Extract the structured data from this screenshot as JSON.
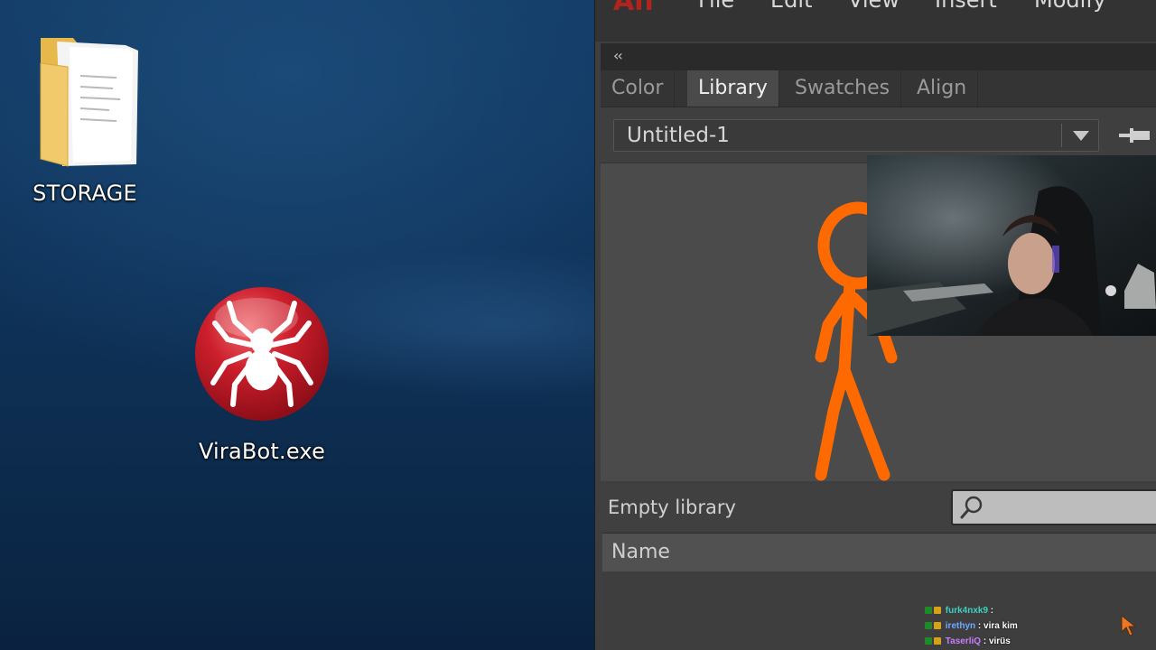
{
  "desktop": {
    "icons": [
      {
        "label": "STORAGE",
        "icon": "folder-icon"
      },
      {
        "label": "ViraBot.exe",
        "icon": "spider-icon",
        "color": "#c8202e"
      }
    ]
  },
  "app": {
    "logo": "An",
    "menu": [
      "File",
      "Edit",
      "View",
      "Insert",
      "Modify"
    ],
    "collapse_glyph": "‹‹",
    "tabs": [
      {
        "label": "Color",
        "active": false
      },
      {
        "label": "Library",
        "active": true
      },
      {
        "label": "Swatches",
        "active": false
      },
      {
        "label": "Align",
        "active": false
      }
    ],
    "document_select": {
      "value": "Untitled-1"
    },
    "library_status": "Empty library",
    "search": {
      "placeholder": ""
    },
    "columns": [
      "Name"
    ],
    "stickfigure_color": "#ff6a00"
  },
  "chat": {
    "messages": [
      {
        "user": "furk4nxk9",
        "user_color": "#3fd1c2",
        "message": "ㅤ"
      },
      {
        "user": "irethyn",
        "user_color": "#6fa8ff",
        "message": "vira kim"
      },
      {
        "user": "TaserliQ",
        "user_color": "#c97cff",
        "message": "virüs"
      }
    ]
  }
}
